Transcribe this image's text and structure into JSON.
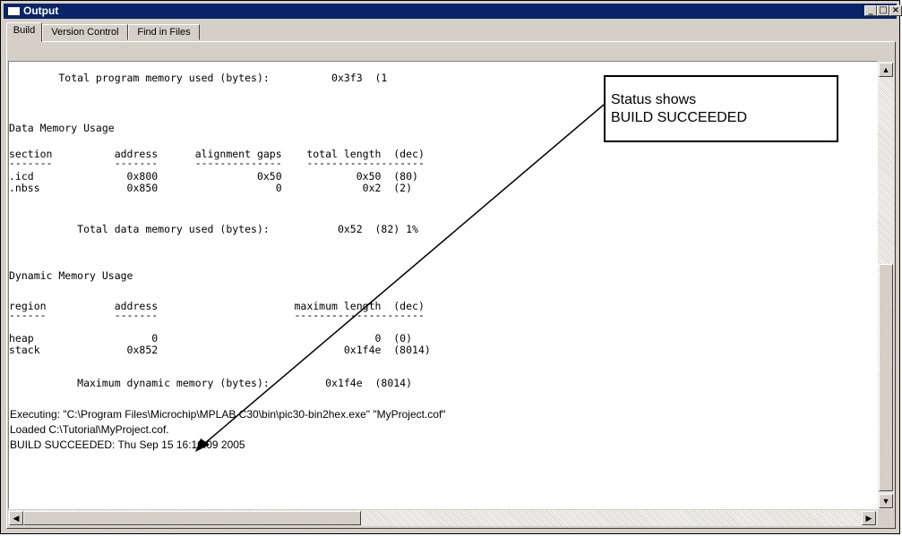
{
  "window": {
    "title": "Output",
    "minimize": "_",
    "maximize": "□",
    "close": "×"
  },
  "tabs": [
    {
      "label": "Build"
    },
    {
      "label": "Version Control"
    },
    {
      "label": "Find in Files"
    }
  ],
  "output": {
    "program_total": "        Total program memory used (bytes):          0x3f3  (1",
    "data_header": "Data Memory Usage",
    "data_cols": "section          address      alignment gaps    total length  (dec)",
    "data_rule": "-------          -------      --------------    -------------------",
    "data_rows": [
      ".icd               0x800                0x50            0x50  (80)",
      ".nbss              0x850                   0             0x2  (2)"
    ],
    "data_total": "           Total data memory used (bytes):           0x52  (82) 1%",
    "dyn_header": "Dynamic Memory Usage",
    "dyn_cols": "region           address                      maximum length  (dec)",
    "dyn_rule": "------           -------                      ---------------------",
    "dyn_rows": [
      "heap                   0                                   0  (0)",
      "stack              0x852                              0x1f4e  (8014)"
    ],
    "dyn_total": "           Maximum dynamic memory (bytes):         0x1f4e  (8014)",
    "messages": [
      "Executing: \"C:\\Program Files\\Microchip\\MPLAB C30\\bin\\pic30-bin2hex.exe\" \"MyProject.cof\"",
      "Loaded C:\\Tutorial\\MyProject.cof.",
      "BUILD SUCCEEDED: Thu Sep 15 16:10:09 2005"
    ]
  },
  "scroll": {
    "up": "▲",
    "down": "▼",
    "left": "◀",
    "right": "▶"
  },
  "callout": {
    "line1": "Status shows",
    "line2": "BUILD SUCCEEDED"
  }
}
